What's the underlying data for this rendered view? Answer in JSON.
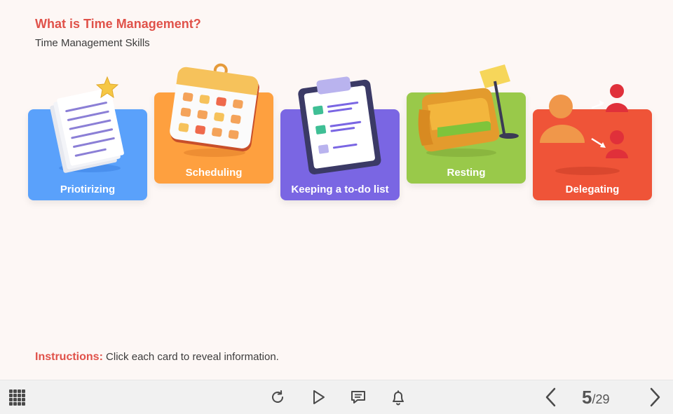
{
  "header": {
    "title": "What is Time Management?",
    "subtitle": "Time Management Skills"
  },
  "cards": [
    {
      "label": "Priotirizing",
      "color": "#5aa1fb",
      "icon": "papers-star-icon"
    },
    {
      "label": "Scheduling",
      "color": "#fea03f",
      "icon": "calendar-icon"
    },
    {
      "label": "Keeping a to-do list",
      "color": "#7a66e3",
      "icon": "clipboard-checklist-icon"
    },
    {
      "label": "Resting",
      "color": "#99c94a",
      "icon": "armchair-lamp-icon"
    },
    {
      "label": "Delegating",
      "color": "#ef5438",
      "icon": "people-delegate-icon"
    }
  ],
  "instructions": {
    "label": "Instructions:",
    "text": " Click each card to reveal information."
  },
  "toolbar": {
    "menu_icon": "grid-menu-icon",
    "replay_icon": "replay-icon",
    "play_icon": "play-icon",
    "comment_icon": "comment-icon",
    "notification_icon": "bell-icon",
    "prev_icon": "chevron-left-icon",
    "next_icon": "chevron-right-icon",
    "page_current": "5",
    "page_separator": "/",
    "page_total": "29"
  },
  "colors": {
    "accent": "#e0524a",
    "background": "#fdf7f5",
    "toolbar": "#f1f1f1"
  }
}
